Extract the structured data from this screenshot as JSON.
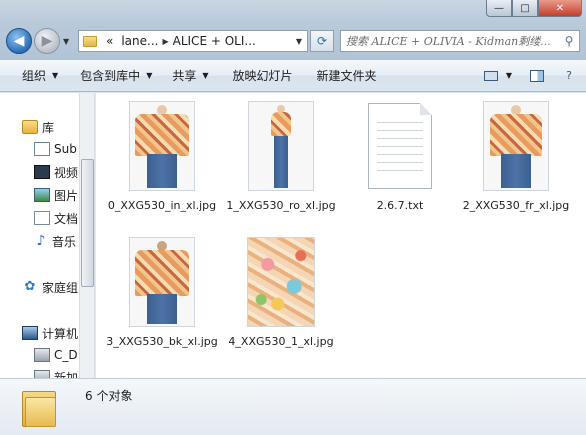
{
  "window": {
    "buttons": {
      "minimize": "—",
      "maximize": "□",
      "close": "✕"
    }
  },
  "address_bar": {
    "overflow": "«",
    "crumbs": [
      "lane...",
      "ALICE + OLI..."
    ],
    "refresh_icon": "refresh-icon"
  },
  "search": {
    "placeholder": "搜索 ALICE + OLIVIA - Kidman剩缕..."
  },
  "toolbar": {
    "organize": "组织",
    "include_in_library": "包含到库中",
    "share": "共享",
    "slideshow": "放映幻灯片",
    "new_folder": "新建文件夹"
  },
  "nav_pane": {
    "libraries": "库",
    "subversion": "Sub",
    "videos": "视频",
    "pictures": "图片",
    "documents": "文档",
    "music": "音乐",
    "homegroup": "家庭组",
    "computer": "计算机",
    "drive_c": "C_D",
    "drive_new": "新加"
  },
  "files": [
    {
      "name": "0_XXG530_in_xl.jpg",
      "kind": "photo-full"
    },
    {
      "name": "1_XXG530_ro_xl.jpg",
      "kind": "photo-standing"
    },
    {
      "name": "2.6.7.txt",
      "kind": "text"
    },
    {
      "name": "2_XXG530_fr_xl.jpg",
      "kind": "photo-full"
    },
    {
      "name": "3_XXG530_bk_xl.jpg",
      "kind": "photo-back"
    },
    {
      "name": "4_XXG530_1_xl.jpg",
      "kind": "fabric"
    }
  ],
  "status": {
    "item_count": "6 个对象"
  },
  "colors": {
    "accent": "#2a6fb7",
    "jacket": "#e99b5d",
    "jeans": "#3b5f8f"
  }
}
